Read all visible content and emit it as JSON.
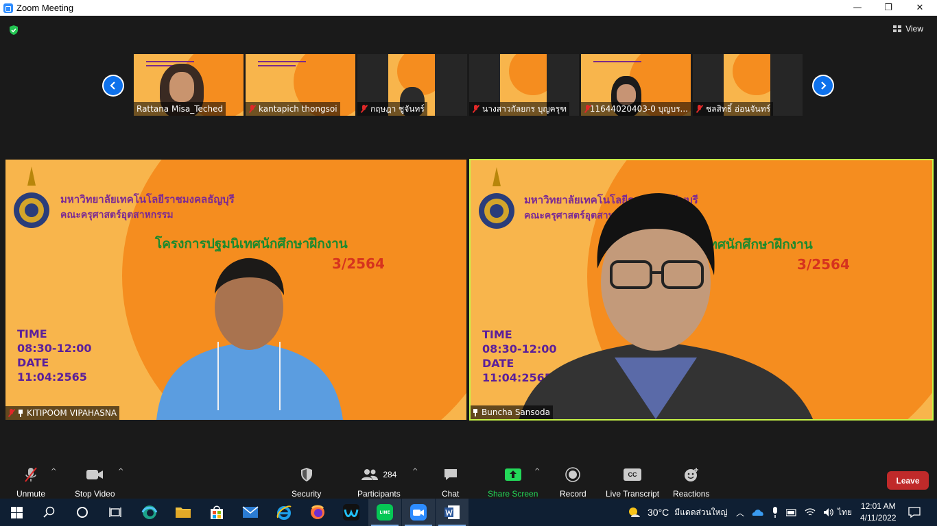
{
  "window": {
    "title": "Zoom Meeting",
    "minimize": "—",
    "maximize": "❐",
    "close": "✕"
  },
  "header": {
    "view_label": "View"
  },
  "thumbnails": [
    {
      "name": "Rattana Misa_Teched",
      "muted": false
    },
    {
      "name": "kantapich thongsoi",
      "muted": true
    },
    {
      "name": "กฤษฎา ชูจันทร์",
      "muted": true
    },
    {
      "name": "นางสาวกัลยกร บุญครุฑ",
      "muted": true
    },
    {
      "name": "11644020403-0 บุญบร...",
      "muted": true
    },
    {
      "name": "ชลสิทธิ์ อ่อนจันทร์",
      "muted": true
    }
  ],
  "slide": {
    "org_line1": "มหาวิทยาลัยเทคโนโลยีราชมงคลธัญบุรี",
    "org_line2": "คณะครุศาสตร์อุตสาหกรรม",
    "project": "โครงการปฐมนิเทศนักศึกษาฝึกงาน",
    "term": "3/2564",
    "time_label": "TIME",
    "time_value": "08:30-12:00",
    "date_label": "DATE",
    "date_value": "11:04:2565"
  },
  "videos": [
    {
      "name": "KITIPOOM VIPAHASNA",
      "muted": true,
      "pinned": true
    },
    {
      "name": "Buncha Sansoda",
      "muted": false,
      "pinned": true,
      "active_speaker": true
    }
  ],
  "toolbar": {
    "unmute": "Unmute",
    "stop_video": "Stop Video",
    "security": "Security",
    "participants": "Participants",
    "participant_count": "284",
    "chat": "Chat",
    "share_screen": "Share Screen",
    "record": "Record",
    "live_transcript": "Live Transcript",
    "reactions": "Reactions",
    "leave": "Leave",
    "cc_icon_text": "CC"
  },
  "taskbar": {
    "weather_temp": "30°C",
    "weather_desc": "มีแดดส่วนใหญ่",
    "language": "ไทย",
    "time": "12:01 AM",
    "date": "4/11/2022",
    "line_icon_text": "LINE"
  },
  "colors": {
    "zoom_blue": "#0e71eb",
    "leave_red": "#c02a2a",
    "share_green": "#23d959",
    "slide_bg": "#f8b54c",
    "slide_circle": "#f58d1f",
    "active_speaker_border": "#c8f547"
  }
}
